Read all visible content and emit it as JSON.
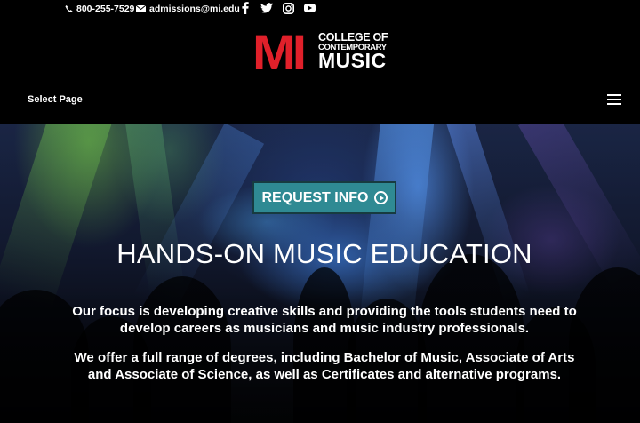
{
  "topbar": {
    "phone": "800-255-7529",
    "email": "admissions@mi.edu",
    "icons": [
      "phone-icon",
      "envelope-icon",
      "facebook-icon",
      "twitter-icon",
      "instagram-icon",
      "youtube-icon"
    ]
  },
  "logo": {
    "mark": "MI",
    "line1": "COLLEGE OF",
    "line2": "CONTEMPORARY",
    "line3": "MUSIC",
    "mark_color": "#e0202a"
  },
  "nav": {
    "select_page": "Select Page",
    "menu_icon": "hamburger-menu-icon"
  },
  "hero": {
    "cta_label": "REQUEST INFO",
    "cta_icon": "play-circle-icon",
    "cta_color": "#2f8a93",
    "headline": "HANDS-ON MUSIC EDUCATION",
    "paragraph1_line1": "Our focus is developing creative skills and providing the tools students need to",
    "paragraph1_line2": "develop careers as musicians and music industry professionals.",
    "paragraph2_line1": "We offer a full range of degrees, including Bachelor of Music, Associate of Arts",
    "paragraph2_line2": "and Associate of Science, as well as Certificates and alternative programs."
  }
}
